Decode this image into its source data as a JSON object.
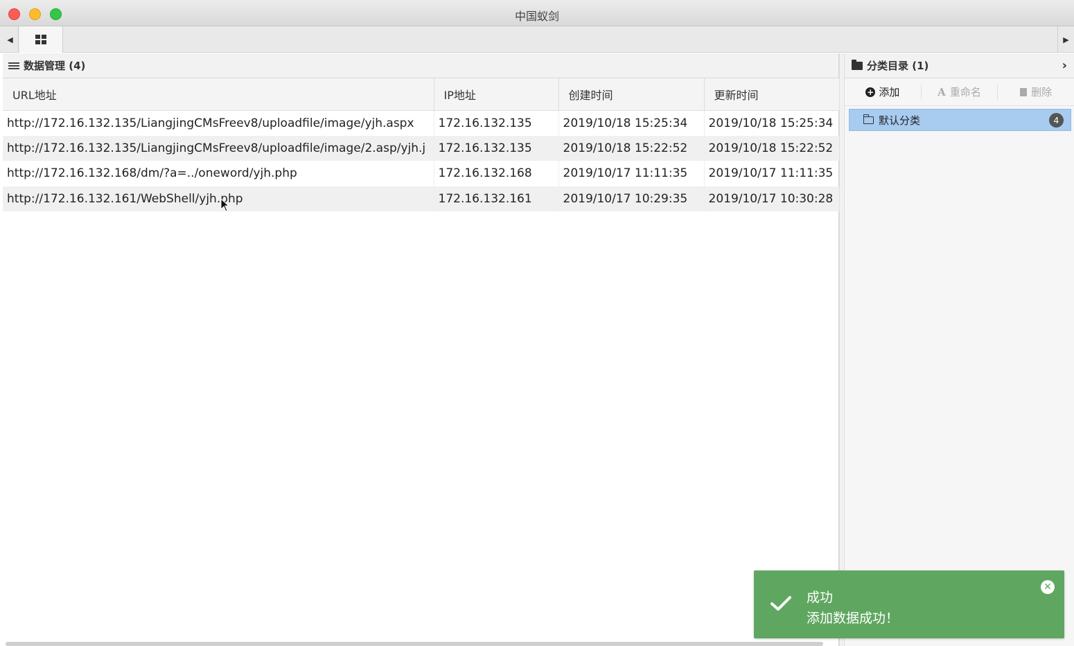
{
  "window": {
    "title": "中国蚁剑"
  },
  "tabbar": {
    "left_arrow": "◀",
    "right_arrow": "▶"
  },
  "data_panel": {
    "title": "数据管理 (4)",
    "columns": [
      "URL地址",
      "IP地址",
      "创建时间",
      "更新时间"
    ],
    "rows": [
      [
        "http://172.16.132.135/LiangjingCMsFreev8/uploadfile/image/yjh.aspx",
        "172.16.132.135",
        "2019/10/18 15:25:34",
        "2019/10/18 15:25:34"
      ],
      [
        "http://172.16.132.135/LiangjingCMsFreev8/uploadfile/image/2.asp/yjh.j",
        "172.16.132.135",
        "2019/10/18 15:22:52",
        "2019/10/18 15:22:52"
      ],
      [
        "http://172.16.132.168/dm/?a=../oneword/yjh.php",
        "172.16.132.168",
        "2019/10/17 11:11:35",
        "2019/10/17 11:11:35"
      ],
      [
        "http://172.16.132.161/WebShell/yjh.php",
        "172.16.132.161",
        "2019/10/17 10:29:35",
        "2019/10/17 10:30:28"
      ]
    ]
  },
  "category_panel": {
    "title": "分类目录 (1)",
    "collapse_icon": "›",
    "toolbar": {
      "add": "添加",
      "rename": "重命名",
      "delete": "删除"
    },
    "categories": [
      {
        "label": "默认分类",
        "count": "4"
      }
    ]
  },
  "toast": {
    "title": "成功",
    "message": "添加数据成功！",
    "close": "✕"
  },
  "colors": {
    "toast_bg": "#5fa760",
    "selected_category": "#a8cbf0"
  }
}
